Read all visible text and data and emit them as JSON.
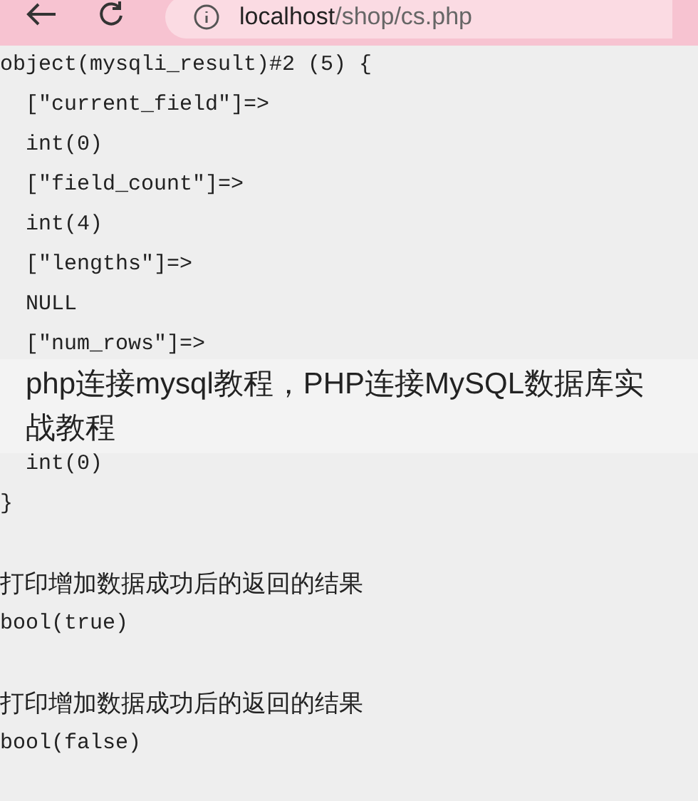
{
  "browser": {
    "url_host": "localhost",
    "url_path": "/shop/cs.php"
  },
  "output": [
    {
      "kind": "code",
      "text": "object(mysqli_result)#2 (5) {",
      "indent": false
    },
    {
      "kind": "code",
      "text": "[\"current_field\"]=>",
      "indent": true
    },
    {
      "kind": "code",
      "text": "int(0)",
      "indent": true
    },
    {
      "kind": "code",
      "text": "[\"field_count\"]=>",
      "indent": true
    },
    {
      "kind": "code",
      "text": "int(4)",
      "indent": true
    },
    {
      "kind": "code",
      "text": "[\"lengths\"]=>",
      "indent": true
    },
    {
      "kind": "code",
      "text": "NULL",
      "indent": true
    },
    {
      "kind": "code",
      "text": "[\"num_rows\"]=>",
      "indent": true
    },
    {
      "kind": "hidden"
    },
    {
      "kind": "hidden"
    },
    {
      "kind": "code",
      "text": "int(0)",
      "indent": true
    },
    {
      "kind": "code",
      "text": "}",
      "indent": false
    },
    {
      "kind": "blank"
    },
    {
      "kind": "text",
      "text": "打印增加数据成功后的返回的结果"
    },
    {
      "kind": "code",
      "text": "bool(true)",
      "indent": false
    },
    {
      "kind": "blank"
    },
    {
      "kind": "text",
      "text": "打印增加数据成功后的返回的结果"
    },
    {
      "kind": "code",
      "text": "bool(false)",
      "indent": false
    }
  ],
  "caption": "php连接mysql教程，PHP连接MySQL数据库实战教程"
}
